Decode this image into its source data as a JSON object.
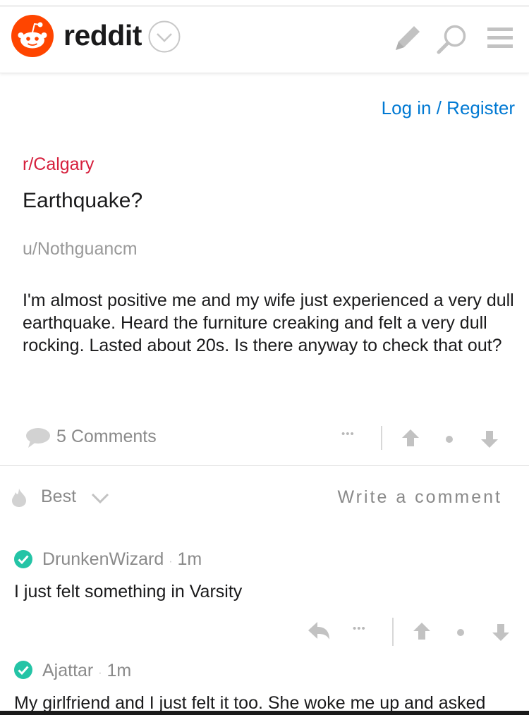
{
  "header": {
    "brand": "reddit",
    "icons": [
      "reddit-logo-icon",
      "chevron-down-icon",
      "pencil-icon",
      "search-icon",
      "menu-icon"
    ]
  },
  "auth": {
    "login_label": "Log in / Register"
  },
  "post": {
    "subreddit": "r/Calgary",
    "title": "Earthquake?",
    "author": "u/Nothguancm",
    "body": "I'm almost positive me and my wife just experienced a very dull earthquake. Heard the furniture creaking and felt a very dull rocking. Lasted about 20s. Is there anyway to check that out?",
    "comments_count": "5 Comments",
    "more": "•••"
  },
  "sort": {
    "label": "Best"
  },
  "write_comment": "Write a comment",
  "comments": [
    {
      "user": "DrunkenWizard",
      "sep": "·",
      "time": "1m",
      "text": "I just felt something in Varsity",
      "more": "•••"
    },
    {
      "user": "Ajattar",
      "sep": "·",
      "time": "1m",
      "text": "My girlfriend and I just felt it too. She woke me up and asked"
    }
  ],
  "colors": {
    "brand": "#ff4500",
    "link": "#0079d3",
    "subreddit": "#d6203d",
    "verified": "#24c4a6",
    "muted": "#8a8a8a"
  }
}
